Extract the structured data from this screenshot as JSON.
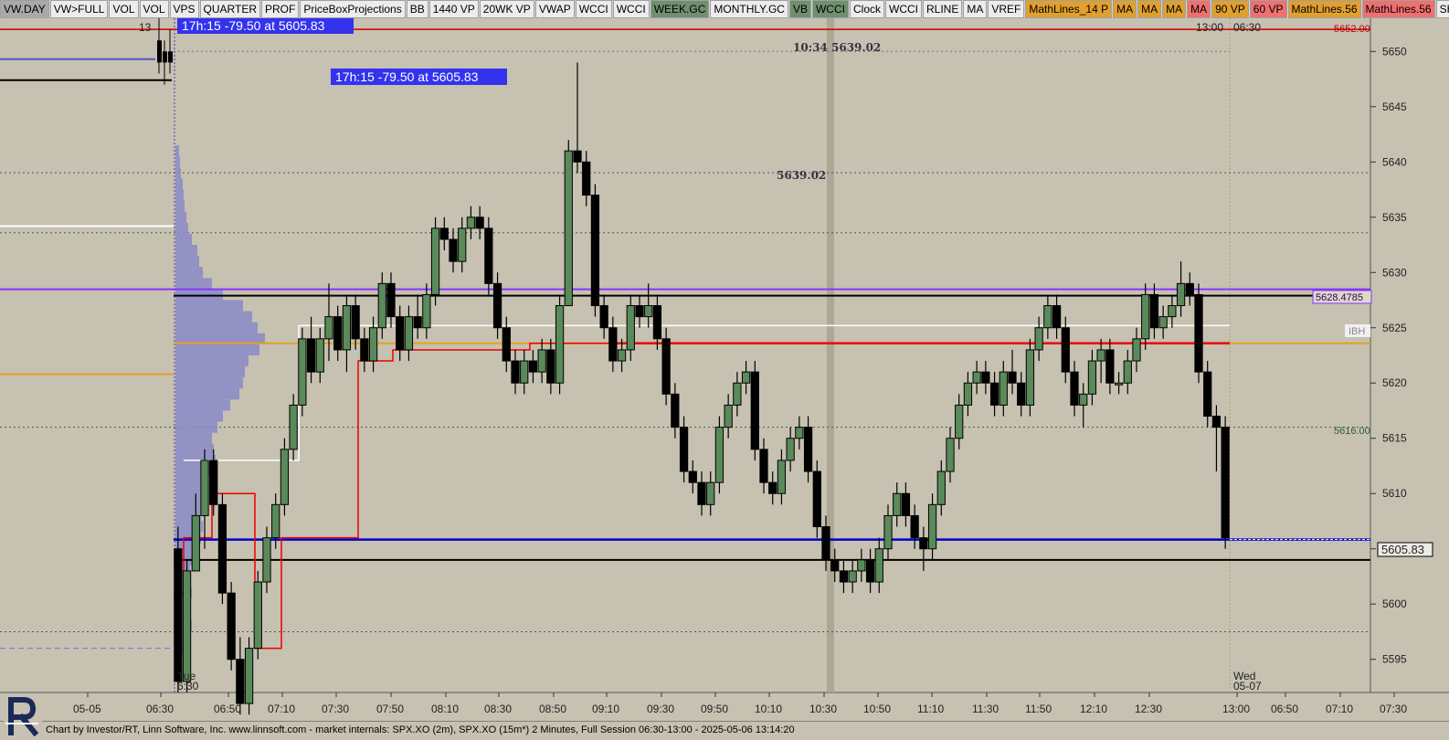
{
  "toolbar": {
    "buttons": [
      {
        "label": "VW.DAY",
        "bg": "#a9a9a9"
      },
      {
        "label": "VW>FULL",
        "bg": "#ececec"
      },
      {
        "label": "VOL",
        "bg": "#ececec"
      },
      {
        "label": "VOL",
        "bg": "#ececec"
      },
      {
        "label": "VPS",
        "bg": "#ececec"
      },
      {
        "label": "QUARTER",
        "bg": "#ececec"
      },
      {
        "label": "PROF",
        "bg": "#ececec"
      },
      {
        "label": "PriceBoxProjections",
        "bg": "#ececec"
      },
      {
        "label": "BB",
        "bg": "#ececec"
      },
      {
        "label": "1440 VP",
        "bg": "#ececec"
      },
      {
        "label": "20WK VP",
        "bg": "#ececec"
      },
      {
        "label": "VWAP",
        "bg": "#ececec"
      },
      {
        "label": "WCCI",
        "bg": "#ececec"
      },
      {
        "label": "WCCI",
        "bg": "#ececec"
      },
      {
        "label": "WEEK.GC",
        "bg": "#6f8f6f"
      },
      {
        "label": "MONTHLY.GC",
        "bg": "#ececec"
      },
      {
        "label": "VB",
        "bg": "#6f8f6f"
      },
      {
        "label": "WCCI",
        "bg": "#6f8f6f"
      },
      {
        "label": "Clock",
        "bg": "#ececec"
      },
      {
        "label": "WCCI",
        "bg": "#ececec"
      },
      {
        "label": "RLINE",
        "bg": "#ececec"
      },
      {
        "label": "MA",
        "bg": "#ececec"
      },
      {
        "label": "VREF",
        "bg": "#ececec"
      },
      {
        "label": "MathLines_14 P",
        "bg": "#e0a030"
      },
      {
        "label": "MA",
        "bg": "#e0a030"
      },
      {
        "label": "MA",
        "bg": "#e0a030"
      },
      {
        "label": "MA",
        "bg": "#e0a030"
      },
      {
        "label": "MA",
        "bg": "#f07070"
      },
      {
        "label": "90 VP",
        "bg": "#e0a030"
      },
      {
        "label": "60 VP",
        "bg": "#f07070"
      },
      {
        "label": "MathLines.56",
        "bg": "#e0a030"
      },
      {
        "label": "MathLines.56",
        "bg": "#f07070"
      },
      {
        "label": "SHAPE",
        "bg": "#ececec"
      },
      {
        "label": "SHA",
        "bg": "#22cc22"
      }
    ]
  },
  "footer": {
    "text": "Chart by Investor/RT, Linn Software, Inc. www.linnsoft.com - market internals: SPX.XO (2m), SPX.XO (15m*) 2 Minutes, Full Session 06:30-13:00 - 2025-05-06 13:14:20"
  },
  "labels": {
    "tooltip": "17h:15  -79.50 at 5605.83",
    "top_left_label": "13",
    "top_right_time_1": "13:00",
    "top_right_time_2": "06:30",
    "top_annot": "10:34  5639.02",
    "mid_annot": "5639.02",
    "tue_label": "Tue",
    "tue_time": "6:30",
    "wed_label": "Wed",
    "wed_date": "05-07"
  },
  "price_tags": {
    "p5652": "5652.00",
    "p5628": "5628.4785",
    "ibh": "IBH",
    "p5616": "5616.00",
    "last": "5605.83"
  },
  "colors": {
    "background": "#c6c1b1",
    "up_candle": "#5a8a5a",
    "down_candle": "#000000",
    "volume_profile": "#8a8ac8",
    "blue_line": "#0000cc",
    "red_line": "#ee0000",
    "purple_line": "#8833ff",
    "orange_line": "#e8a020",
    "session_marker": "#a8a290"
  },
  "chart_data": {
    "type": "candlestick",
    "interval": "2 Minutes",
    "ylim": [
      5592,
      5653
    ],
    "y_ticks": [
      5595,
      5600,
      5605,
      5610,
      5615,
      5620,
      5625,
      5630,
      5635,
      5640,
      5645,
      5650
    ],
    "x_ticks": [
      "05-05",
      "06:30",
      "06:50",
      "07:10",
      "07:30",
      "07:50",
      "08:10",
      "08:30",
      "08:50",
      "09:10",
      "09:30",
      "09:50",
      "10:10",
      "10:30",
      "10:50",
      "11:10",
      "11:30",
      "11:50",
      "12:10",
      "12:30",
      "13:00",
      "06:50",
      "07:10",
      "07:30"
    ],
    "series_ohlc": [
      [
        5605,
        5607,
        5592,
        5593
      ],
      [
        5593,
        5604,
        5592,
        5603
      ],
      [
        5603,
        5610,
        5603,
        5608
      ],
      [
        5608,
        5614,
        5605,
        5613
      ],
      [
        5613,
        5614,
        5608,
        5609
      ],
      [
        5609,
        5610,
        5600,
        5601
      ],
      [
        5601,
        5602,
        5594,
        5595
      ],
      [
        5595,
        5597,
        5590,
        5591
      ],
      [
        5591,
        5597,
        5590,
        5596
      ],
      [
        5596,
        5603,
        5595,
        5602
      ],
      [
        5602,
        5607,
        5601,
        5606
      ],
      [
        5606,
        5610,
        5605,
        5609
      ],
      [
        5609,
        5615,
        5608,
        5614
      ],
      [
        5614,
        5619,
        5613,
        5618
      ],
      [
        5618,
        5625,
        5617,
        5624
      ],
      [
        5624,
        5626,
        5620,
        5621
      ],
      [
        5621,
        5625,
        5620,
        5624
      ],
      [
        5624,
        5629,
        5622,
        5626
      ],
      [
        5626,
        5627,
        5622,
        5623
      ],
      [
        5623,
        5628,
        5621,
        5627
      ],
      [
        5627,
        5628,
        5623,
        5624
      ],
      [
        5624,
        5625,
        5621,
        5622
      ],
      [
        5622,
        5626,
        5621,
        5625
      ],
      [
        5625,
        5630,
        5624,
        5629
      ],
      [
        5629,
        5630,
        5625,
        5626
      ],
      [
        5626,
        5627,
        5622,
        5623
      ],
      [
        5623,
        5627,
        5622,
        5626
      ],
      [
        5626,
        5628,
        5624,
        5625
      ],
      [
        5625,
        5629,
        5624,
        5628
      ],
      [
        5628,
        5635,
        5627,
        5634
      ],
      [
        5634,
        5635,
        5632,
        5633
      ],
      [
        5633,
        5634,
        5630,
        5631
      ],
      [
        5631,
        5635,
        5630,
        5634
      ],
      [
        5634,
        5636,
        5633,
        5635
      ],
      [
        5635,
        5636,
        5633,
        5634
      ],
      [
        5634,
        5635,
        5628,
        5629
      ],
      [
        5629,
        5630,
        5624,
        5625
      ],
      [
        5625,
        5626,
        5621,
        5622
      ],
      [
        5622,
        5623,
        5619,
        5620
      ],
      [
        5620,
        5623,
        5619,
        5622
      ],
      [
        5622,
        5623,
        5620,
        5621
      ],
      [
        5621,
        5624,
        5620,
        5623
      ],
      [
        5623,
        5624,
        5619,
        5620
      ],
      [
        5620,
        5628,
        5619,
        5627
      ],
      [
        5627,
        5642,
        5627,
        5641
      ],
      [
        5641,
        5649,
        5639,
        5640
      ],
      [
        5640,
        5641,
        5636,
        5637
      ],
      [
        5637,
        5638,
        5626,
        5627
      ],
      [
        5627,
        5628,
        5624,
        5625
      ],
      [
        5625,
        5626,
        5621,
        5622
      ],
      [
        5622,
        5624,
        5621,
        5623
      ],
      [
        5623,
        5628,
        5622,
        5627
      ],
      [
        5627,
        5628,
        5625,
        5626
      ],
      [
        5626,
        5629,
        5625,
        5627
      ],
      [
        5627,
        5628,
        5623,
        5624
      ],
      [
        5624,
        5625,
        5618,
        5619
      ],
      [
        5619,
        5620,
        5615,
        5616
      ],
      [
        5616,
        5617,
        5611,
        5612
      ],
      [
        5612,
        5613,
        5610,
        5611
      ],
      [
        5611,
        5612,
        5608,
        5609
      ],
      [
        5609,
        5612,
        5608,
        5611
      ],
      [
        5611,
        5617,
        5610,
        5616
      ],
      [
        5616,
        5619,
        5615,
        5618
      ],
      [
        5618,
        5621,
        5617,
        5620
      ],
      [
        5620,
        5622,
        5619,
        5621
      ],
      [
        5621,
        5622,
        5613,
        5614
      ],
      [
        5614,
        5615,
        5610,
        5611
      ],
      [
        5611,
        5612,
        5609,
        5610
      ],
      [
        5610,
        5614,
        5609,
        5613
      ],
      [
        5613,
        5616,
        5612,
        5615
      ],
      [
        5615,
        5617,
        5614,
        5616
      ],
      [
        5616,
        5617,
        5611,
        5612
      ],
      [
        5612,
        5613,
        5606,
        5607
      ],
      [
        5607,
        5608,
        5603,
        5604
      ],
      [
        5604,
        5605,
        5602,
        5603
      ],
      [
        5603,
        5604,
        5601,
        5602
      ],
      [
        5602,
        5604,
        5601,
        5603
      ],
      [
        5603,
        5605,
        5602,
        5604
      ],
      [
        5604,
        5605,
        5601,
        5602
      ],
      [
        5602,
        5606,
        5601,
        5605
      ],
      [
        5605,
        5609,
        5604,
        5608
      ],
      [
        5608,
        5611,
        5607,
        5610
      ],
      [
        5610,
        5611,
        5607,
        5608
      ],
      [
        5608,
        5609,
        5605,
        5606
      ],
      [
        5606,
        5607,
        5603,
        5605
      ],
      [
        5605,
        5610,
        5604,
        5609
      ],
      [
        5609,
        5613,
        5608,
        5612
      ],
      [
        5612,
        5616,
        5611,
        5615
      ],
      [
        5615,
        5619,
        5614,
        5618
      ],
      [
        5618,
        5621,
        5617,
        5620
      ],
      [
        5620,
        5622,
        5619,
        5621
      ],
      [
        5621,
        5622,
        5619,
        5620
      ],
      [
        5620,
        5621,
        5617,
        5618
      ],
      [
        5618,
        5622,
        5617,
        5621
      ],
      [
        5621,
        5623,
        5619,
        5620
      ],
      [
        5620,
        5621,
        5617,
        5618
      ],
      [
        5618,
        5624,
        5617,
        5623
      ],
      [
        5623,
        5626,
        5622,
        5625
      ],
      [
        5625,
        5628,
        5624,
        5627
      ],
      [
        5627,
        5628,
        5624,
        5625
      ],
      [
        5625,
        5626,
        5620,
        5621
      ],
      [
        5621,
        5622,
        5617,
        5618
      ],
      [
        5618,
        5620,
        5616,
        5619
      ],
      [
        5619,
        5623,
        5618,
        5622
      ],
      [
        5622,
        5624,
        5620,
        5623
      ],
      [
        5623,
        5624,
        5619,
        5620
      ],
      [
        5620,
        5621,
        5619,
        5620
      ],
      [
        5620,
        5623,
        5619,
        5622
      ],
      [
        5622,
        5625,
        5621,
        5624
      ],
      [
        5624,
        5629,
        5623,
        5628
      ],
      [
        5628,
        5629,
        5624,
        5625
      ],
      [
        5625,
        5627,
        5624,
        5626
      ],
      [
        5626,
        5628,
        5625,
        5627
      ],
      [
        5627,
        5631,
        5626,
        5629
      ],
      [
        5629,
        5630,
        5627,
        5628
      ],
      [
        5628,
        5629,
        5620,
        5621
      ],
      [
        5621,
        5622,
        5616,
        5617
      ],
      [
        5617,
        5618,
        5612,
        5616
      ],
      [
        5616,
        5617,
        5605,
        5606
      ]
    ],
    "levels": [
      {
        "price": 5652.0,
        "label": "5652.00"
      },
      {
        "price": 5628.4785,
        "label": "5628.4785"
      },
      {
        "price": 5616.0,
        "label": "5616.00"
      },
      {
        "price": 5605.83,
        "label": "5605.83"
      }
    ]
  }
}
